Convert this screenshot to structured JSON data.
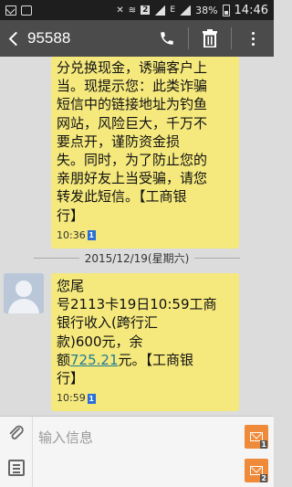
{
  "status_bar": {
    "sim1": "2",
    "network": "E",
    "battery": "38%",
    "time": "14:46"
  },
  "header": {
    "contact": "95588",
    "icons": [
      "back-icon",
      "phone-icon",
      "trash-icon",
      "overflow-menu-icon"
    ]
  },
  "messages": [
    {
      "id": "m1",
      "direction": "outgoing",
      "lines": [
        "分兑换现金，诱骗客户上",
        "当。现提示您：此类诈骗",
        "短信中的链接地址为钓鱼",
        "网站，风险巨大，千万不",
        "要点开，谨防资金损",
        "失。同时，为了防止您的",
        "亲朋好友上当受骗，请您",
        "转发此短信。【工商银",
        "行】"
      ],
      "time": "10:36",
      "sim": "1"
    },
    {
      "id": "m2",
      "direction": "incoming",
      "lines_before": [
        "您尾",
        "号2113卡19日10:59工商",
        "银行收入(跨行汇",
        "款)600元，余"
      ],
      "amount_prefix": "额",
      "amount_link": "725.21",
      "amount_suffix": "元。【工商银",
      "last_line": "行】",
      "time": "10:59",
      "sim": "1"
    }
  ],
  "date_separator": "2015/12/19(星期六)",
  "compose": {
    "placeholder": "输入信息",
    "send_sim1": "1",
    "send_sim2": "2"
  },
  "colors": {
    "bubble": "#f5e97d",
    "header": "#4b4b4b",
    "background": "#dcdcdc",
    "send_button": "#ee8a3a",
    "link": "#1e7a96"
  }
}
